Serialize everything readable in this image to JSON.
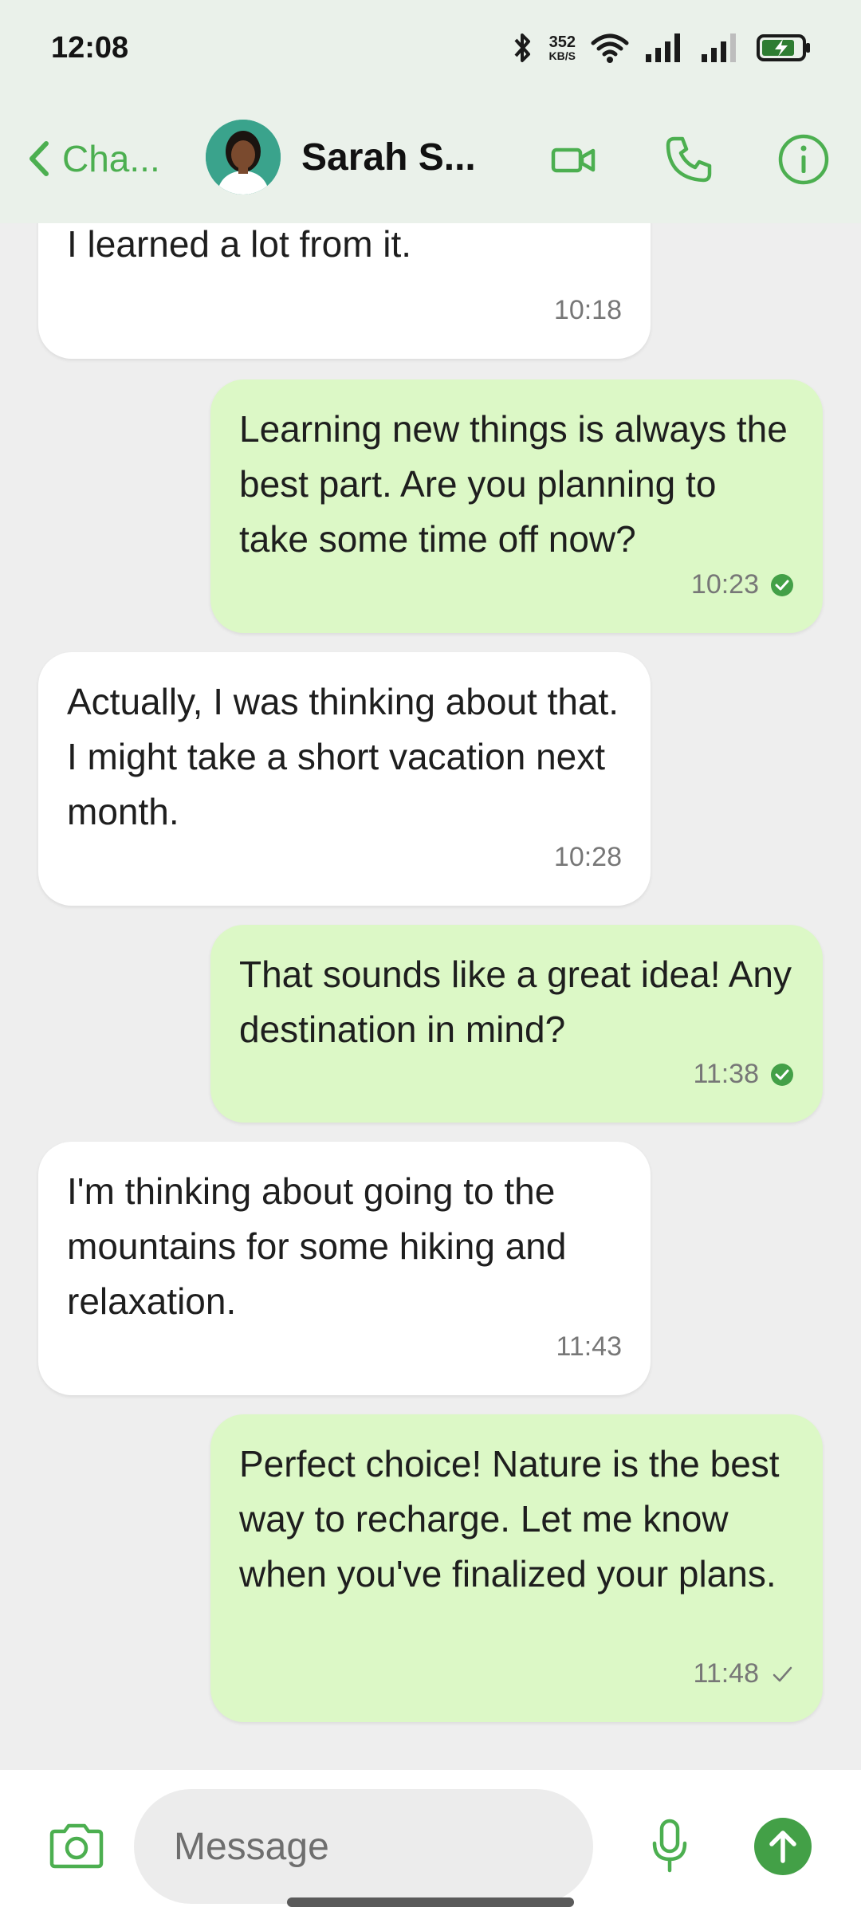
{
  "status_bar": {
    "time": "12:08",
    "net_speed_value": "352",
    "net_speed_unit": "KB/S",
    "battery_color": "#2e7d32"
  },
  "header": {
    "back_label": "Cha...",
    "contact_name": "Sarah S...",
    "accent_color": "#4caf50",
    "icons": [
      "video-call-icon",
      "phone-icon",
      "info-icon"
    ]
  },
  "messages": [
    {
      "direction": "in",
      "text": "I learned a lot from it.",
      "time": "10:18"
    },
    {
      "direction": "out",
      "text": "Learning new things is always the best part. Are you planning to take some time off now?",
      "time": "10:23",
      "status": "read"
    },
    {
      "direction": "in",
      "text": "Actually, I was thinking about that. I might take a short vacation next month.",
      "time": "10:28"
    },
    {
      "direction": "out",
      "text": "That sounds like a great idea! Any destination in mind?",
      "time": "11:38",
      "status": "read"
    },
    {
      "direction": "in",
      "text": "I'm thinking about going to the mountains for some hiking and relaxation.",
      "time": "11:43"
    },
    {
      "direction": "out",
      "text": "Perfect choice! Nature is the best way to recharge. Let me know when you've finalized your plans.",
      "time": "11:48",
      "status": "sent"
    }
  ],
  "input": {
    "placeholder": "Message"
  },
  "colors": {
    "incoming_bubble": "#ffffff",
    "outgoing_bubble": "#dcf8c6",
    "send_button": "#43a047"
  }
}
